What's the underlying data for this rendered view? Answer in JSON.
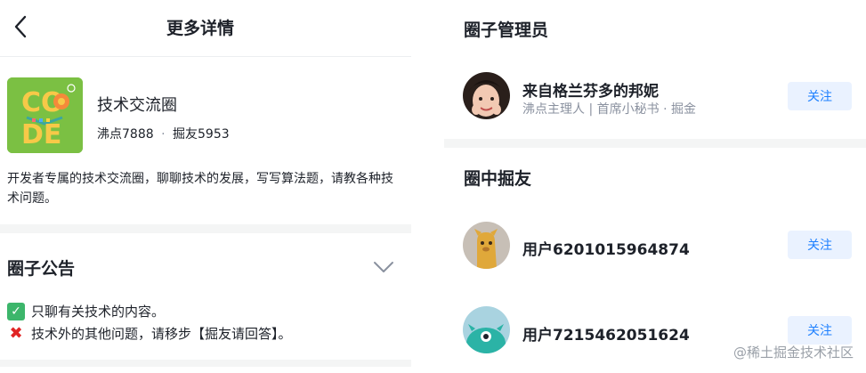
{
  "header": {
    "title": "更多详情",
    "back_icon": "chevron-left-icon"
  },
  "circle": {
    "logo_text_top": "CO",
    "logo_text_bottom": "DE",
    "name": "技术交流圈",
    "stats_points_label": "沸点7888",
    "stats_separator": "·",
    "stats_members_label": "掘友5953",
    "description": "开发者专属的技术交流圈，聊聊技术的发展，写写算法题，请教各种技术问题。"
  },
  "notice": {
    "title": "圈子公告",
    "expand_icon": "chevron-down-icon",
    "lines": [
      {
        "icon": "check-mark-icon",
        "text": "只聊有关技术的内容。"
      },
      {
        "icon": "cross-mark-icon",
        "text": "技术外的其他问题，请移步【掘友请回答】。"
      }
    ]
  },
  "admins": {
    "title": "圈子管理员",
    "items": [
      {
        "name": "来自格兰芬多的邦妮",
        "subtitle": "沸点主理人 | 首席小秘书 · 掘金",
        "follow_label": "关注"
      }
    ]
  },
  "members": {
    "title": "圈中掘友",
    "items": [
      {
        "name": "用户6201015964874",
        "follow_label": "关注"
      },
      {
        "name": "用户7215462051624",
        "follow_label": "关注"
      }
    ]
  },
  "watermark": "@稀土掘金技术社区",
  "colors": {
    "accent": "#1e80ff",
    "follow_bg": "#eaf2ff",
    "logo_bg": "#7bc043",
    "divider": "#f4f5f5"
  }
}
